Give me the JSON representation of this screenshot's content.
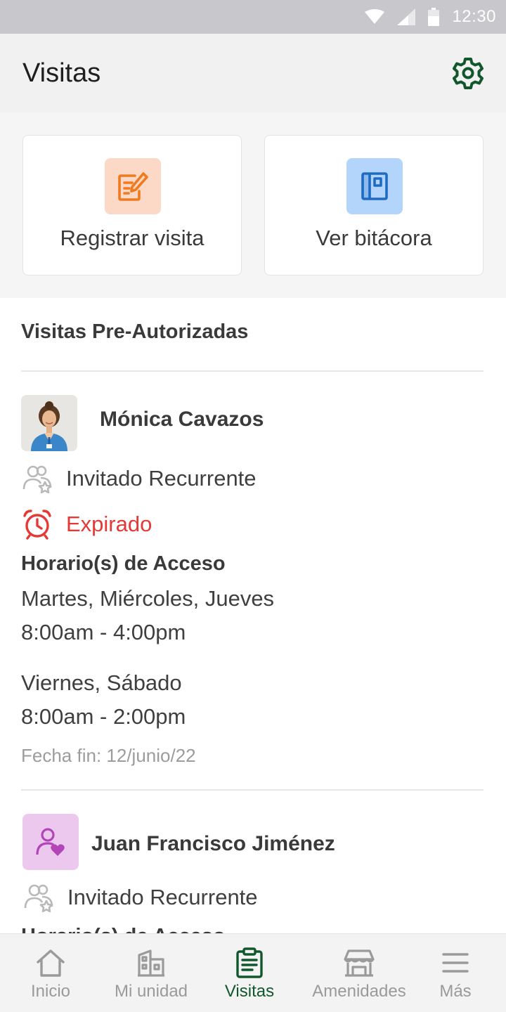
{
  "status_bar": {
    "time": "12:30"
  },
  "header": {
    "title": "Visitas"
  },
  "actions": [
    {
      "label": "Registrar visita",
      "icon": "edit-document-icon",
      "icon_bg": "#fbd9c6",
      "icon_color": "#f07a1f"
    },
    {
      "label": "Ver bitácora",
      "icon": "logbook-icon",
      "icon_bg": "#b3d5fb",
      "icon_color": "#1e6bc4"
    }
  ],
  "section": {
    "title": "Visitas Pre-Autorizadas"
  },
  "visitors": [
    {
      "name": "Mónica Cavazos",
      "type": "Invitado Recurrente",
      "status": "Expirado",
      "access_title": "Horario(s) de Acceso",
      "schedules": [
        {
          "days": "Martes, Miércoles, Jueves",
          "hours": "8:00am - 4:00pm"
        },
        {
          "days": "Viernes, Sábado",
          "hours": "8:00am - 2:00pm"
        }
      ],
      "end_date": "Fecha fin: 12/junio/22"
    },
    {
      "name": "Juan Francisco Jiménez",
      "type": "Invitado Recurrente",
      "access_title": "Horario(s) de Acceso"
    }
  ],
  "bottom_nav": [
    {
      "label": "Inicio",
      "icon": "home-icon"
    },
    {
      "label": "Mi unidad",
      "icon": "building-icon"
    },
    {
      "label": "Visitas",
      "icon": "clipboard-icon",
      "active": true
    },
    {
      "label": "Amenidades",
      "icon": "store-icon"
    },
    {
      "label": "Más",
      "icon": "menu-icon"
    }
  ],
  "colors": {
    "accent": "#12572c",
    "expired": "#e53935",
    "inactive": "#9a9a9a"
  }
}
